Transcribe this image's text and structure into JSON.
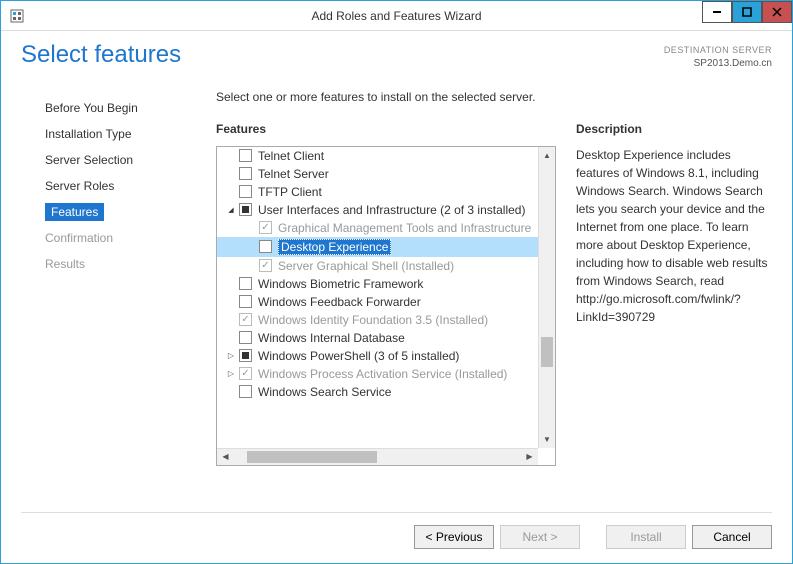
{
  "window": {
    "title": "Add Roles and Features Wizard"
  },
  "header": {
    "page_title": "Select features",
    "destination_label": "DESTINATION SERVER",
    "destination_server": "SP2013.Demo.cn"
  },
  "sidebar": {
    "items": [
      {
        "label": "Before You Begin",
        "state": "normal"
      },
      {
        "label": "Installation Type",
        "state": "normal"
      },
      {
        "label": "Server Selection",
        "state": "normal"
      },
      {
        "label": "Server Roles",
        "state": "normal"
      },
      {
        "label": "Features",
        "state": "active"
      },
      {
        "label": "Confirmation",
        "state": "disabled"
      },
      {
        "label": "Results",
        "state": "disabled"
      }
    ]
  },
  "main": {
    "prompt": "Select one or more features to install on the selected server.",
    "features_heading": "Features",
    "description_heading": "Description",
    "description": "Desktop Experience includes features of Windows 8.1, including Windows Search. Windows Search lets you search your device and the Internet from one place. To learn more about Desktop Experience, including how to disable web results from Windows Search, read http://go.microsoft.com/fwlink/?LinkId=390729",
    "tree": [
      {
        "indent": 0,
        "expander": "",
        "check": "unchecked",
        "label": "Telnet Client",
        "disabled": false
      },
      {
        "indent": 0,
        "expander": "",
        "check": "unchecked",
        "label": "Telnet Server",
        "disabled": false
      },
      {
        "indent": 0,
        "expander": "",
        "check": "unchecked",
        "label": "TFTP Client",
        "disabled": false
      },
      {
        "indent": 0,
        "expander": "▲",
        "check": "mixed",
        "label": "User Interfaces and Infrastructure (2 of 3 installed)",
        "disabled": false
      },
      {
        "indent": 1,
        "expander": "",
        "check": "checked",
        "label": "Graphical Management Tools and Infrastructure",
        "disabled": true
      },
      {
        "indent": 1,
        "expander": "",
        "check": "unchecked",
        "label": "Desktop Experience",
        "disabled": false,
        "selected": true
      },
      {
        "indent": 1,
        "expander": "",
        "check": "checked",
        "label": "Server Graphical Shell (Installed)",
        "disabled": true
      },
      {
        "indent": 0,
        "expander": "",
        "check": "unchecked",
        "label": "Windows Biometric Framework",
        "disabled": false
      },
      {
        "indent": 0,
        "expander": "",
        "check": "unchecked",
        "label": "Windows Feedback Forwarder",
        "disabled": false
      },
      {
        "indent": 0,
        "expander": "",
        "check": "checked",
        "label": "Windows Identity Foundation 3.5 (Installed)",
        "disabled": true
      },
      {
        "indent": 0,
        "expander": "",
        "check": "unchecked",
        "label": "Windows Internal Database",
        "disabled": false
      },
      {
        "indent": 0,
        "expander": "▷",
        "check": "mixed",
        "label": "Windows PowerShell (3 of 5 installed)",
        "disabled": false
      },
      {
        "indent": 0,
        "expander": "▷",
        "check": "checked",
        "label": "Windows Process Activation Service (Installed)",
        "disabled": true
      },
      {
        "indent": 0,
        "expander": "",
        "check": "unchecked",
        "label": "Windows Search Service",
        "disabled": false
      }
    ]
  },
  "footer": {
    "previous": "< Previous",
    "next": "Next >",
    "install": "Install",
    "cancel": "Cancel"
  }
}
